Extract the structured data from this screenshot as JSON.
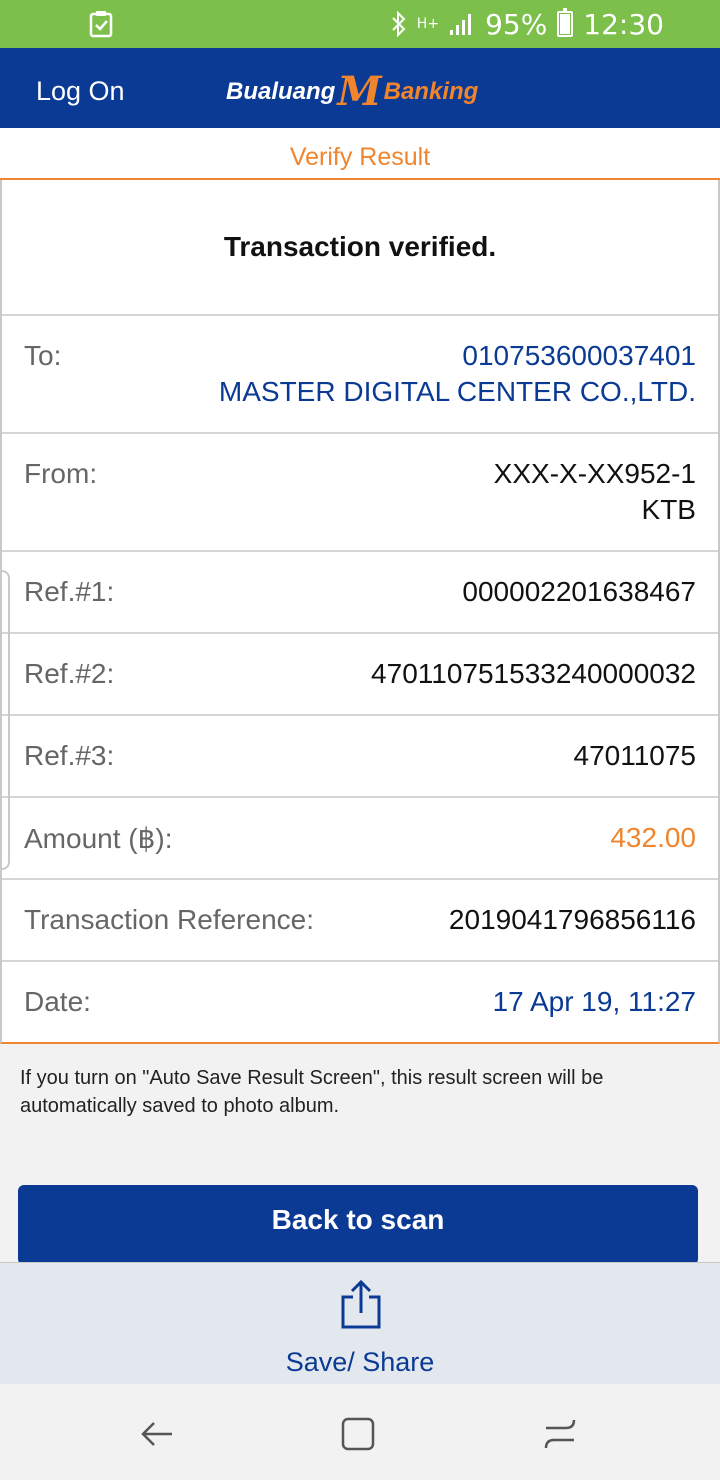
{
  "status_bar": {
    "left_icon": "clipboard-check-icon",
    "bluetooth_icon": "bluetooth-icon",
    "network_type": "H+",
    "signal_icon": "signal-icon",
    "battery_percent": "95%",
    "time": "12:30"
  },
  "header": {
    "log_on_label": "Log On",
    "brand_left": "Bualuang",
    "brand_m": "M",
    "brand_right": "Banking"
  },
  "verify_title": "Verify Result",
  "result": {
    "message": "Transaction verified.",
    "to": {
      "label": "To:",
      "account": "010753600037401",
      "name": "MASTER DIGITAL CENTER CO.,LTD."
    },
    "from": {
      "label": "From:",
      "account": "XXX-X-XX952-1",
      "bank": "KTB"
    },
    "ref1": {
      "label": "Ref.#1:",
      "value": "000002201638467"
    },
    "ref2": {
      "label": "Ref.#2:",
      "value": "470110751533240000032"
    },
    "ref3": {
      "label": "Ref.#3:",
      "value": "47011075"
    },
    "amount": {
      "label": "Amount (฿):",
      "value": "432.00"
    },
    "transaction_reference": {
      "label": "Transaction Reference:",
      "value": "2019041796856116"
    },
    "date": {
      "label": "Date:",
      "value": "17 Apr 19, 11:27"
    }
  },
  "info_text": "If you turn on \"Auto Save Result Screen\", this result screen will be automatically saved to photo album.",
  "back_button_label": "Back to scan",
  "share": {
    "icon": "share-icon",
    "label": "Save/ Share"
  },
  "nav": {
    "back_icon": "back-arrow-icon",
    "home_icon": "home-icon",
    "recents_icon": "recents-icon"
  },
  "colors": {
    "header_blue": "#0b3a95",
    "accent_orange": "#f0852d",
    "status_green": "#7cc04b"
  }
}
